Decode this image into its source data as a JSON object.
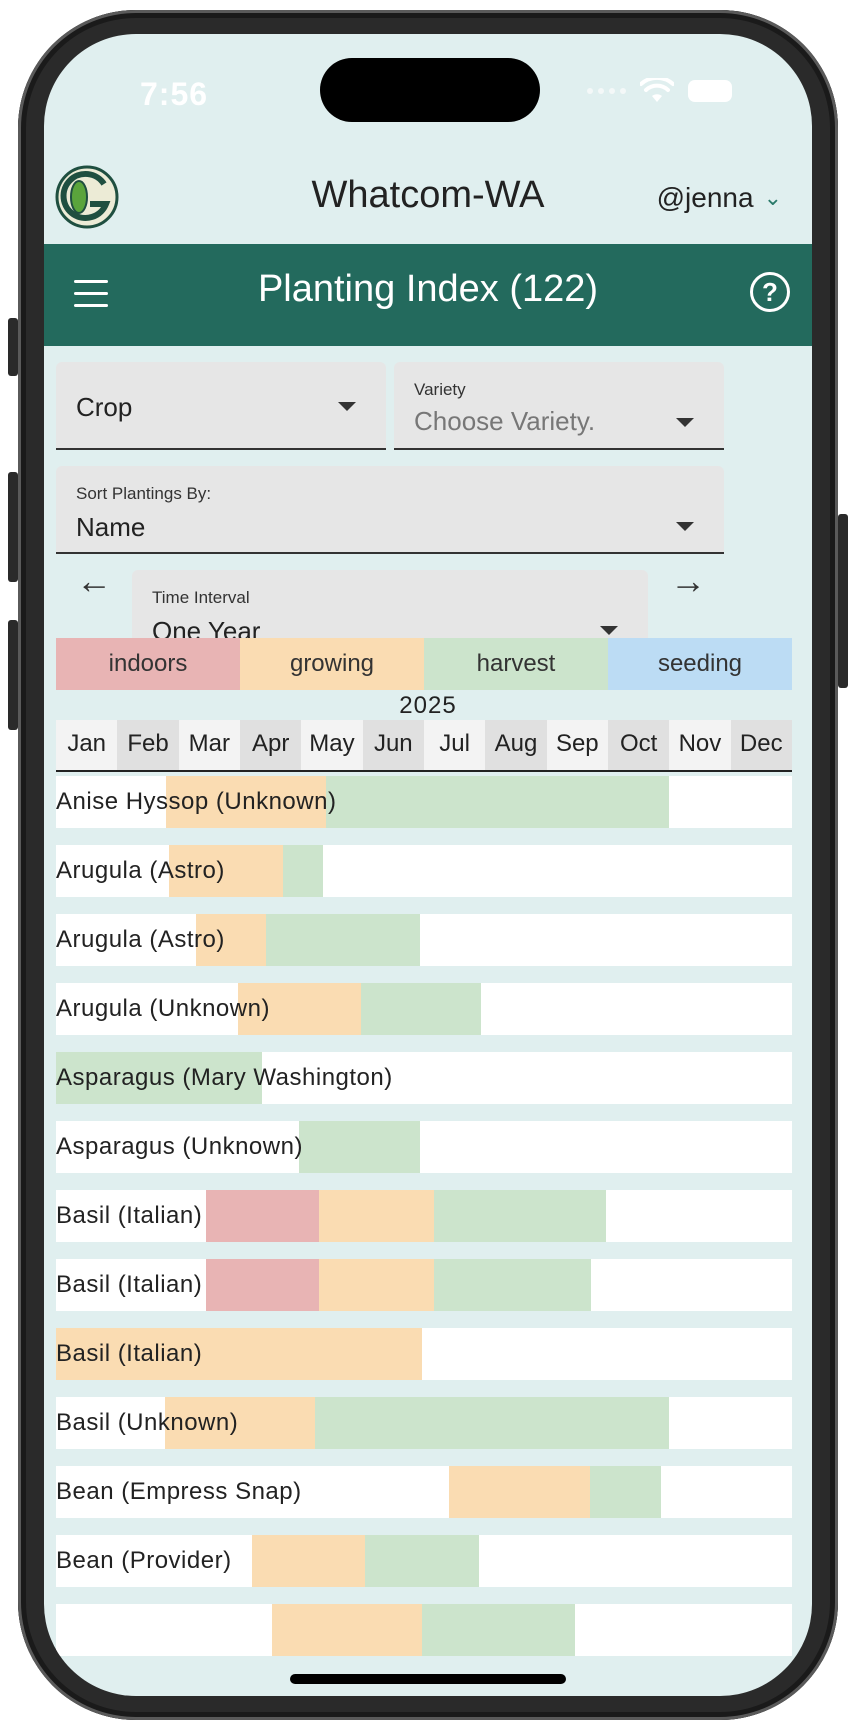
{
  "status_bar": {
    "time": "7:56"
  },
  "header": {
    "location": "Whatcom-WA",
    "user": "@jenna"
  },
  "toolbar": {
    "title": "Planting Index (122)"
  },
  "filters": {
    "crop": {
      "value": "Crop"
    },
    "variety": {
      "label": "Variety",
      "placeholder": "Choose Variety."
    },
    "sort": {
      "label": "Sort Plantings By:",
      "value": "Name"
    },
    "interval": {
      "label": "Time Interval",
      "value": "One Year"
    }
  },
  "legend": [
    {
      "label": "indoors",
      "color": "#e8b4b4"
    },
    {
      "label": "growing",
      "color": "#fadcb2"
    },
    {
      "label": "harvest",
      "color": "#cce4cc"
    },
    {
      "label": "seeding",
      "color": "#bcdcf4"
    }
  ],
  "year": "2025",
  "months": [
    "Jan",
    "Feb",
    "Mar",
    "Apr",
    "May",
    "Jun",
    "Jul",
    "Aug",
    "Sep",
    "Oct",
    "Nov",
    "Dec"
  ],
  "plantings": [
    {
      "name": "Anise Hyssop (Unknown)",
      "segments": [
        {
          "stage": "growing",
          "start": 1.8,
          "end": 4.4
        },
        {
          "stage": "harvest",
          "start": 4.4,
          "end": 9.99
        }
      ]
    },
    {
      "name": "Arugula (Astro)",
      "segments": [
        {
          "stage": "growing",
          "start": 1.85,
          "end": 3.7
        },
        {
          "stage": "harvest",
          "start": 3.7,
          "end": 4.35
        }
      ]
    },
    {
      "name": "Arugula (Astro)",
      "segments": [
        {
          "stage": "growing",
          "start": 2.28,
          "end": 3.43
        },
        {
          "stage": "harvest",
          "start": 3.43,
          "end": 5.93
        }
      ]
    },
    {
      "name": "Arugula (Unknown)",
      "segments": [
        {
          "stage": "growing",
          "start": 2.96,
          "end": 4.97
        },
        {
          "stage": "harvest",
          "start": 4.97,
          "end": 6.93
        }
      ]
    },
    {
      "name": "Asparagus (Mary Washington)",
      "segments": [
        {
          "stage": "harvest",
          "start": 0,
          "end": 3.36
        }
      ]
    },
    {
      "name": "Asparagus (Unknown)",
      "segments": [
        {
          "stage": "harvest",
          "start": 3.96,
          "end": 5.93
        }
      ]
    },
    {
      "name": "Basil (Italian)",
      "segments": [
        {
          "stage": "indoors",
          "start": 2.44,
          "end": 4.29
        },
        {
          "stage": "growing",
          "start": 4.29,
          "end": 6.16
        },
        {
          "stage": "harvest",
          "start": 6.16,
          "end": 8.96
        }
      ]
    },
    {
      "name": "Basil (Italian)",
      "segments": [
        {
          "stage": "indoors",
          "start": 2.44,
          "end": 4.29
        },
        {
          "stage": "growing",
          "start": 4.29,
          "end": 6.16
        },
        {
          "stage": "harvest",
          "start": 6.16,
          "end": 8.73
        }
      ]
    },
    {
      "name": "Basil (Italian)",
      "segments": [
        {
          "stage": "growing",
          "start": 0,
          "end": 5.96
        }
      ]
    },
    {
      "name": "Basil (Unknown)",
      "segments": [
        {
          "stage": "growing",
          "start": 1.77,
          "end": 4.22
        },
        {
          "stage": "harvest",
          "start": 4.22,
          "end": 9.99
        }
      ]
    },
    {
      "name": "Bean (Empress Snap)",
      "segments": [
        {
          "stage": "growing",
          "start": 6.4,
          "end": 8.7
        },
        {
          "stage": "harvest",
          "start": 8.7,
          "end": 9.86
        }
      ]
    },
    {
      "name": "Bean (Provider)",
      "segments": [
        {
          "stage": "growing",
          "start": 3.2,
          "end": 5.03
        },
        {
          "stage": "harvest",
          "start": 5.03,
          "end": 6.9
        }
      ]
    },
    {
      "name": "",
      "segments": [
        {
          "stage": "growing",
          "start": 3.52,
          "end": 5.97
        },
        {
          "stage": "harvest",
          "start": 5.97,
          "end": 8.47
        }
      ]
    }
  ]
}
